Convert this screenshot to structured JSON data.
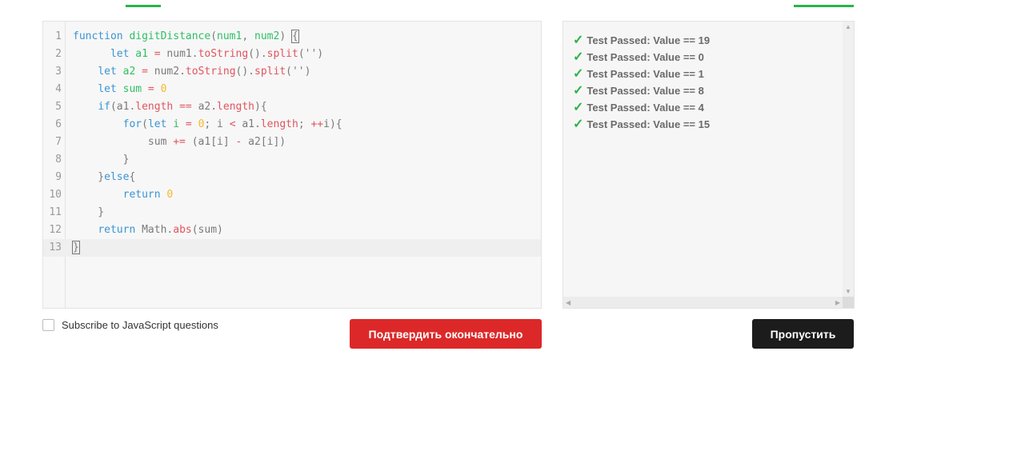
{
  "colors": {
    "accent": "#2cb34a",
    "submit": "#dc2828",
    "skip": "#1c1c1c"
  },
  "editor": {
    "active_line": 13,
    "lines": [
      [
        [
          "kw",
          "function "
        ],
        [
          "def",
          "digitDistance"
        ],
        [
          "p",
          "("
        ],
        [
          "def",
          "num1"
        ],
        [
          "p",
          ", "
        ],
        [
          "def",
          "num2"
        ],
        [
          "p",
          ") "
        ],
        [
          "br",
          "{"
        ]
      ],
      [
        [
          "p",
          "      "
        ],
        [
          "kw",
          "let "
        ],
        [
          "def",
          "a1"
        ],
        [
          "op",
          " = "
        ],
        [
          "p",
          "num1."
        ],
        [
          "prop",
          "toString"
        ],
        [
          "p",
          "()."
        ],
        [
          "prop",
          "split"
        ],
        [
          "p",
          "('')"
        ]
      ],
      [
        [
          "p",
          "    "
        ],
        [
          "kw",
          "let "
        ],
        [
          "def",
          "a2"
        ],
        [
          "op",
          " = "
        ],
        [
          "p",
          "num2."
        ],
        [
          "prop",
          "toString"
        ],
        [
          "p",
          "()."
        ],
        [
          "prop",
          "split"
        ],
        [
          "p",
          "('')"
        ]
      ],
      [
        [
          "p",
          "    "
        ],
        [
          "kw",
          "let "
        ],
        [
          "def",
          "sum"
        ],
        [
          "op",
          " = "
        ],
        [
          "num",
          "0"
        ]
      ],
      [
        [
          "p",
          "    "
        ],
        [
          "kw",
          "if"
        ],
        [
          "p",
          "(a1."
        ],
        [
          "prop",
          "length"
        ],
        [
          "op",
          " == "
        ],
        [
          "p",
          "a2."
        ],
        [
          "prop",
          "length"
        ],
        [
          "p",
          "){"
        ]
      ],
      [
        [
          "p",
          "        "
        ],
        [
          "kw",
          "for"
        ],
        [
          "p",
          "("
        ],
        [
          "kw",
          "let "
        ],
        [
          "def",
          "i"
        ],
        [
          "op",
          " = "
        ],
        [
          "num",
          "0"
        ],
        [
          "p",
          "; i "
        ],
        [
          "op",
          "<"
        ],
        [
          "p",
          " a1."
        ],
        [
          "prop",
          "length"
        ],
        [
          "p",
          "; "
        ],
        [
          "op",
          "++"
        ],
        [
          "p",
          "i){"
        ]
      ],
      [
        [
          "p",
          "            sum "
        ],
        [
          "op",
          "+="
        ],
        [
          "p",
          " (a1[i] "
        ],
        [
          "op",
          "-"
        ],
        [
          "p",
          " a2[i])"
        ]
      ],
      [
        [
          "p",
          "        }"
        ]
      ],
      [
        [
          "p",
          "    }"
        ],
        [
          "kw",
          "else"
        ],
        [
          "p",
          "{"
        ]
      ],
      [
        [
          "p",
          "        "
        ],
        [
          "kw",
          "return "
        ],
        [
          "num",
          "0"
        ]
      ],
      [
        [
          "p",
          "    }"
        ]
      ],
      [
        [
          "p",
          "    "
        ],
        [
          "kw",
          "return "
        ],
        [
          "p",
          "Math."
        ],
        [
          "prop",
          "abs"
        ],
        [
          "p",
          "(sum)"
        ]
      ],
      [
        [
          "br",
          "}"
        ]
      ]
    ]
  },
  "results": [
    {
      "icon": "check-icon",
      "glyph": "✓",
      "text": "Test Passed: Value == 19"
    },
    {
      "icon": "check-icon",
      "glyph": "✓",
      "text": "Test Passed: Value == 0"
    },
    {
      "icon": "check-icon",
      "glyph": "✓",
      "text": "Test Passed: Value == 1"
    },
    {
      "icon": "check-icon",
      "glyph": "✓",
      "text": "Test Passed: Value == 8"
    },
    {
      "icon": "check-icon",
      "glyph": "✓",
      "text": "Test Passed: Value == 4"
    },
    {
      "icon": "check-icon",
      "glyph": "✓",
      "text": "Test Passed: Value == 15"
    }
  ],
  "subscribe_label": "Subscribe to JavaScript questions",
  "submit_label": "Подтвердить окончательно",
  "skip_label": "Пропустить"
}
